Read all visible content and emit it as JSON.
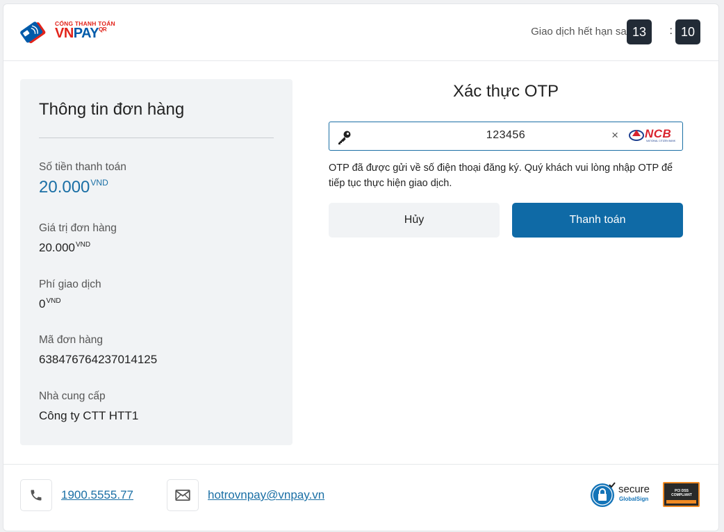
{
  "header": {
    "logo_top": "CỔNG THANH TOÁN",
    "logo_vn": "VN",
    "logo_pay": "PAY",
    "logo_qr": "QR",
    "timer_label": "Giao dịch hết hạn sau",
    "timer_minutes": "13",
    "timer_separator": ":",
    "timer_seconds": "10"
  },
  "order": {
    "title": "Thông tin đơn hàng",
    "fields": [
      {
        "label": "Số tiền thanh toán",
        "value": "20.000",
        "unit": "VND"
      },
      {
        "label": "Giá trị đơn hàng",
        "value": "20.000",
        "unit": "VND"
      },
      {
        "label": "Phí giao dịch",
        "value": "0",
        "unit": "VND"
      },
      {
        "label": "Mã đơn hàng",
        "value": "638476764237014125"
      },
      {
        "label": "Nhà cung cấp",
        "value": "Công ty CTT HTT1"
      }
    ]
  },
  "otp": {
    "title": "Xác thực OTP",
    "value": "123456",
    "clear": "×",
    "bank": "NCB",
    "bank_sub": "NATIONAL CITIZEN BANK",
    "note": "OTP đã được gửi về số điện thoại đăng ký. Quý khách vui lòng nhập OTP để tiếp tục thực hiện giao dịch.",
    "cancel_label": "Hủy",
    "pay_label": "Thanh toán"
  },
  "footer": {
    "phone": "1900.5555.77",
    "email": "hotrovnpay@vnpay.vn",
    "secure_label": "secure",
    "secure_sub": "GlobalSign",
    "pci_label": "PCI DSS COMPLIANT"
  },
  "colors": {
    "accent": "#0f6aa6",
    "link": "#1a6fa5",
    "timer_bg": "#222b36",
    "logo_red": "#e2231a",
    "logo_blue": "#005baa"
  },
  "icons": [
    "key-icon",
    "close-icon",
    "phone-icon",
    "mail-icon",
    "lock-icon"
  ]
}
